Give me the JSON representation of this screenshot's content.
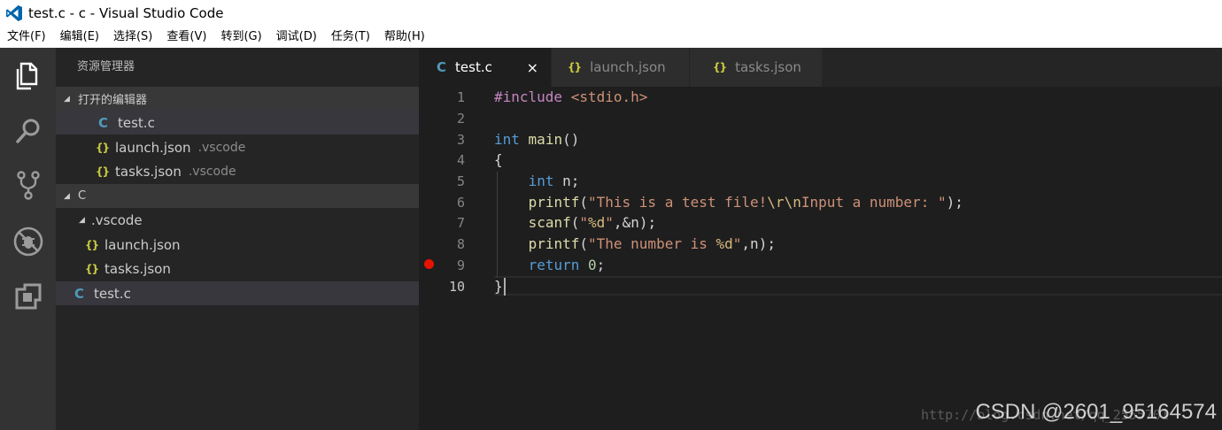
{
  "window": {
    "title": "test.c - c - Visual Studio Code"
  },
  "menu": [
    "文件(F)",
    "编辑(E)",
    "选择(S)",
    "查看(V)",
    "转到(G)",
    "调试(D)",
    "任务(T)",
    "帮助(H)"
  ],
  "activity_bar": [
    "explorer-icon",
    "search-icon",
    "source-control-icon",
    "debug-icon",
    "extensions-icon"
  ],
  "sidebar": {
    "title": "资源管理器",
    "open_editors": {
      "label": "打开的编辑器",
      "items": [
        {
          "icon": "C",
          "name": "test.c",
          "folder": ""
        },
        {
          "icon": "{}",
          "name": "launch.json",
          "folder": ".vscode"
        },
        {
          "icon": "{}",
          "name": "tasks.json",
          "folder": ".vscode"
        }
      ]
    },
    "folder": {
      "label": "C",
      "subfolder": ".vscode",
      "sub_items": [
        {
          "icon": "{}",
          "name": "launch.json"
        },
        {
          "icon": "{}",
          "name": "tasks.json"
        }
      ],
      "file": {
        "icon": "C",
        "name": "test.c"
      }
    }
  },
  "tabs": [
    {
      "icon": "C",
      "label": "test.c",
      "active": true,
      "close": "×"
    },
    {
      "icon": "{}",
      "label": "launch.json",
      "active": false
    },
    {
      "icon": "{}",
      "label": "tasks.json",
      "active": false
    }
  ],
  "editor": {
    "line_numbers": [
      "1",
      "2",
      "3",
      "4",
      "5",
      "6",
      "7",
      "8",
      "9",
      "10"
    ],
    "current_line": 10,
    "breakpoint_line": 9,
    "lines": [
      "#include <stdio.h>",
      "",
      "int main()",
      "{",
      "    int n;",
      "    printf(\"This is a test file!\\r\\nInput a number: \");",
      "    scanf(\"%d\",&n);",
      "    printf(\"The number is %d\",n);",
      "    return 0;",
      "}"
    ]
  },
  "watermark": {
    "text": "CSDN @2601_95164574",
    "url": "http://blog.csdn.net/qq_2555701"
  },
  "colors": {
    "keyword": "#569cd6",
    "preprocessor": "#c586c0",
    "string": "#ce9178",
    "escape": "#d7ba7d",
    "number": "#b5cea8",
    "function": "#dcdcaa",
    "c_icon": "#519aba",
    "json_icon": "#cbcb41",
    "breakpoint": "#e51400"
  }
}
